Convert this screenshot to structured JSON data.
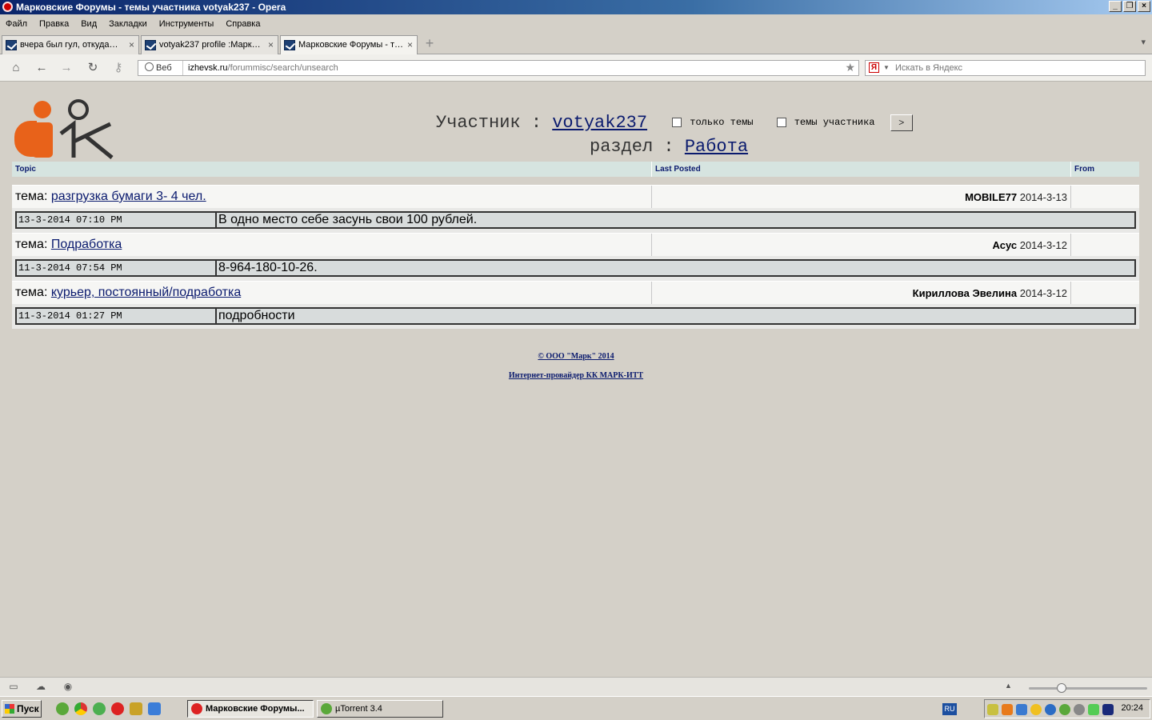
{
  "window": {
    "title": "Марковские Форумы - темы участника votyak237 - Opera",
    "buttons": [
      "_",
      "❐",
      "×"
    ]
  },
  "menu": [
    "Файл",
    "Правка",
    "Вид",
    "Закладки",
    "Инструменты",
    "Справка"
  ],
  "tabs": [
    {
      "label": "вчера был гул, откуда…",
      "close": "×"
    },
    {
      "label": "votyak237 profile :Марк…",
      "close": "×"
    },
    {
      "label": "Марковские Форумы - т…",
      "close": "×"
    }
  ],
  "address": {
    "web_label": "Веб",
    "domain": "izhevsk.ru",
    "path": "/forummisc/search/unsearch"
  },
  "search": {
    "engine_icon": "Я",
    "placeholder": "Искать в Яндекс"
  },
  "header": {
    "member_label": "Участник :",
    "member_name": "votyak237",
    "only_topics_label": "только темы",
    "member_topics_label": "темы участника",
    "go_label": ">",
    "section_label": "раздел :",
    "section_name": "Работа"
  },
  "table": {
    "columns": [
      "Topic",
      "Last Posted",
      "From"
    ],
    "rows": [
      {
        "topic_prefix": "тема:",
        "topic_title": "разгрузка бумаги 3- 4 чел.",
        "last_user": "MOBILE77",
        "last_date": "2014-3-13",
        "post_date": "13-3-2014 07:10 PM",
        "post_text": "В одно место себе засунь свои 100 рублей."
      },
      {
        "topic_prefix": "тема:",
        "topic_title": "Подработка",
        "last_user": "Асус",
        "last_date": "2014-3-12",
        "post_date": "11-3-2014 07:54 PM",
        "post_text": "8-964-180-10-26."
      },
      {
        "topic_prefix": "тема:",
        "topic_title": "курьер, постоянный/подработка",
        "last_user": "Кириллова Эвелина",
        "last_date": "2014-3-12",
        "post_date": "11-3-2014 01:27 PM",
        "post_text": "подробности"
      }
    ]
  },
  "footer": {
    "copyright": "© ООО \"Марк\" 2014",
    "provider": "Интернет-провайдер КК МАРК-ИТТ"
  },
  "taskbar": {
    "start_label": "Пуск",
    "tasks": [
      "Марковские Форумы...",
      "µTorrent 3.4"
    ],
    "lang": "RU",
    "clock": "20:24"
  },
  "colors": {
    "link": "#0a1a6e",
    "logo_orange": "#e8621a",
    "page_bg": "#d4d0c8",
    "header_row": "#d6e4e0"
  }
}
